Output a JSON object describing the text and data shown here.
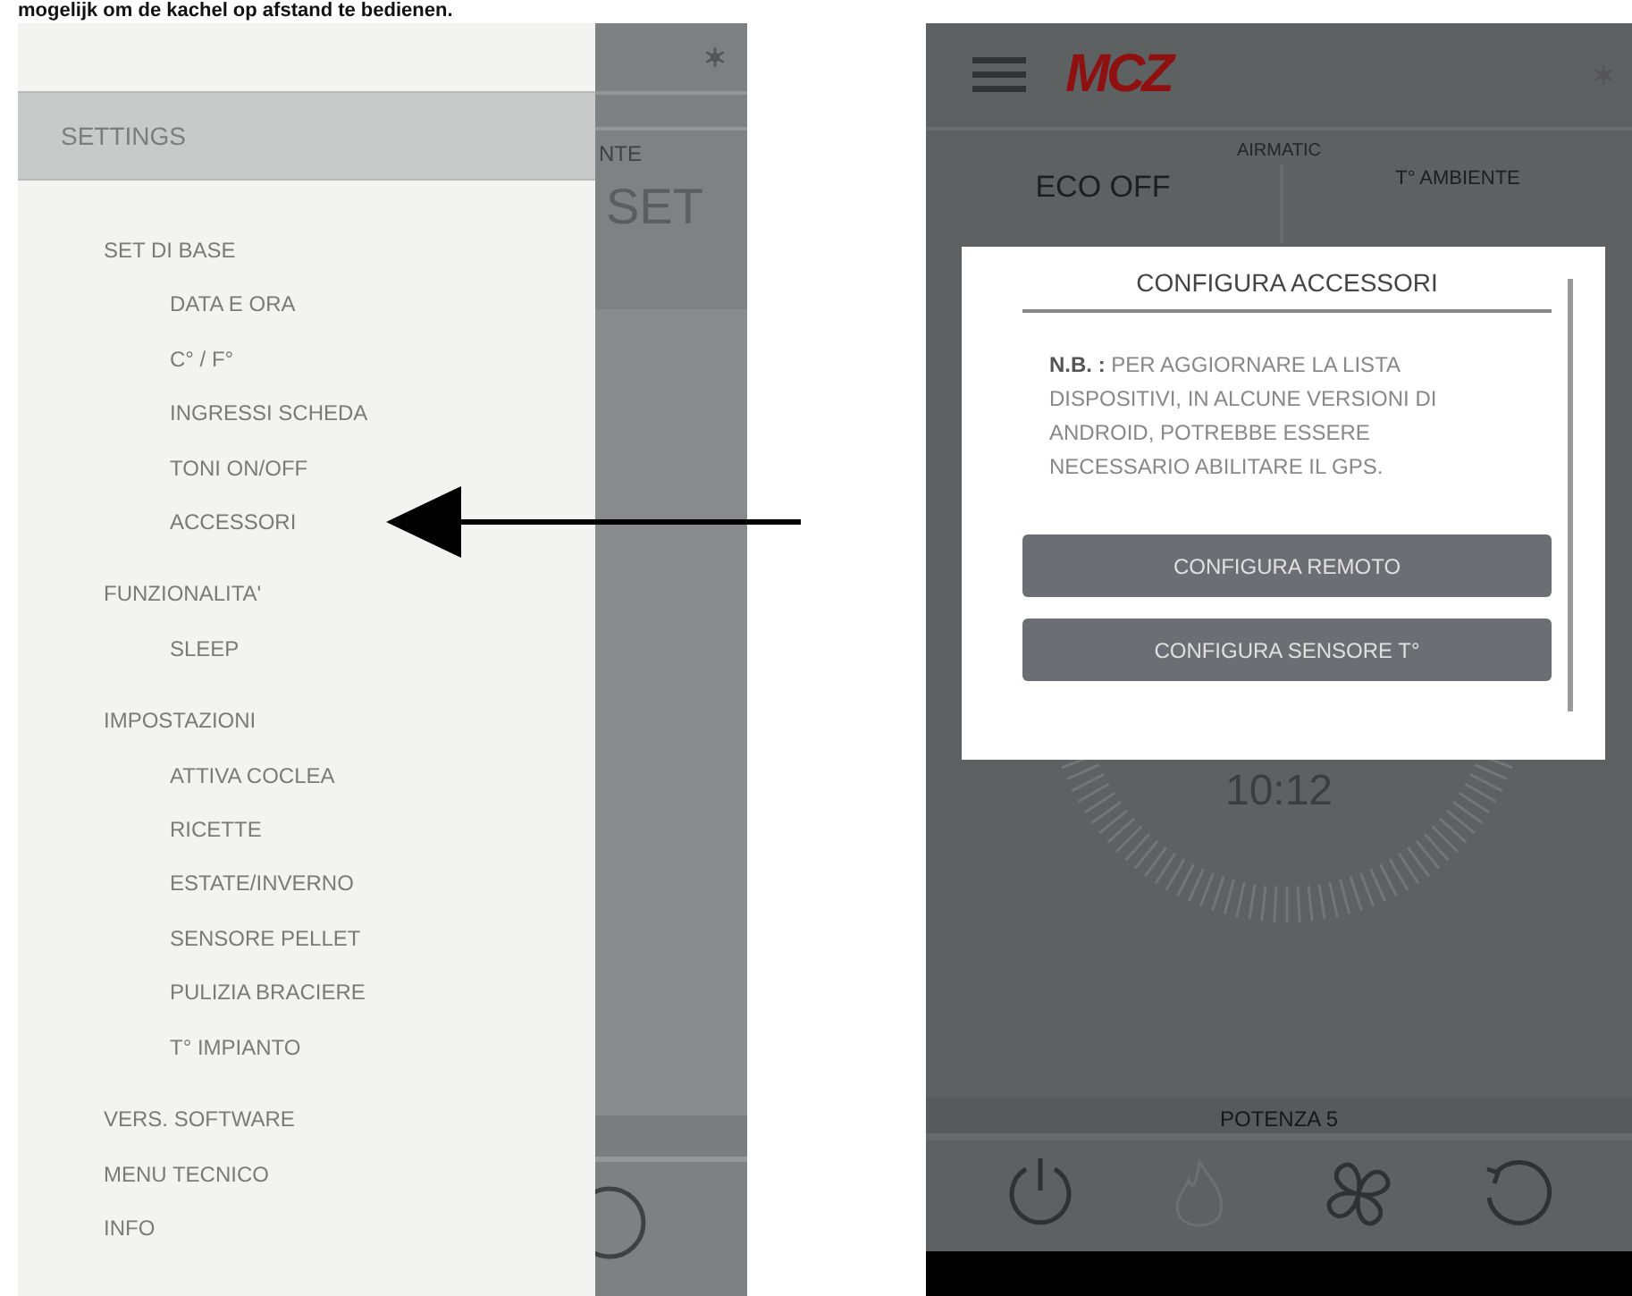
{
  "caption": "mogelijk om de kachel op afstand te bedienen.",
  "left_phone": {
    "drawer_title": "SETTINGS",
    "menu": [
      {
        "label": "SET DI BASE",
        "children": [
          {
            "label": "DATA E ORA"
          },
          {
            "label": "C° / F°"
          },
          {
            "label": "INGRESSI SCHEDA"
          },
          {
            "label": "TONI ON/OFF"
          },
          {
            "label": "ACCESSORI"
          }
        ]
      },
      {
        "label": "FUNZIONALITA'",
        "children": [
          {
            "label": "SLEEP"
          }
        ]
      },
      {
        "label": "IMPOSTAZIONI",
        "children": [
          {
            "label": "ATTIVA COCLEA"
          },
          {
            "label": "RICETTE"
          },
          {
            "label": "ESTATE/INVERNO"
          },
          {
            "label": "SENSORE PELLET"
          },
          {
            "label": "PULIZIA BRACIERE"
          },
          {
            "label": "T° IMPIANTO"
          }
        ]
      },
      {
        "label": "VERS. SOFTWARE"
      },
      {
        "label": "MENU TECNICO"
      },
      {
        "label": "INFO"
      }
    ],
    "behind": {
      "column_label": "NTE",
      "set_label": "SET"
    }
  },
  "right_phone": {
    "logo": "MCZ",
    "mode": "AIRMATIC",
    "eco": "ECO OFF",
    "ambient_label": "T° AMBIENTE",
    "dialog": {
      "title": "CONFIGURA ACCESSORI",
      "note": "**N.B. :** PER AGGIORNARE LA LISTA DISPOSITIVI, IN ALCUNE VERSIONI DI ANDROID, POTREBBE ESSERE NECESSARIO ABILITARE IL GPS.",
      "buttons": [
        "CONFIGURA REMOTO",
        "CONFIGURA SENSORE T°"
      ]
    },
    "time": "10:12",
    "power_level": "POTENZA 5",
    "controls": [
      {
        "kind": "power",
        "disabled": false
      },
      {
        "kind": "flame",
        "disabled": true
      },
      {
        "kind": "fan",
        "disabled": false
      },
      {
        "kind": "refresh",
        "disabled": false
      }
    ]
  }
}
